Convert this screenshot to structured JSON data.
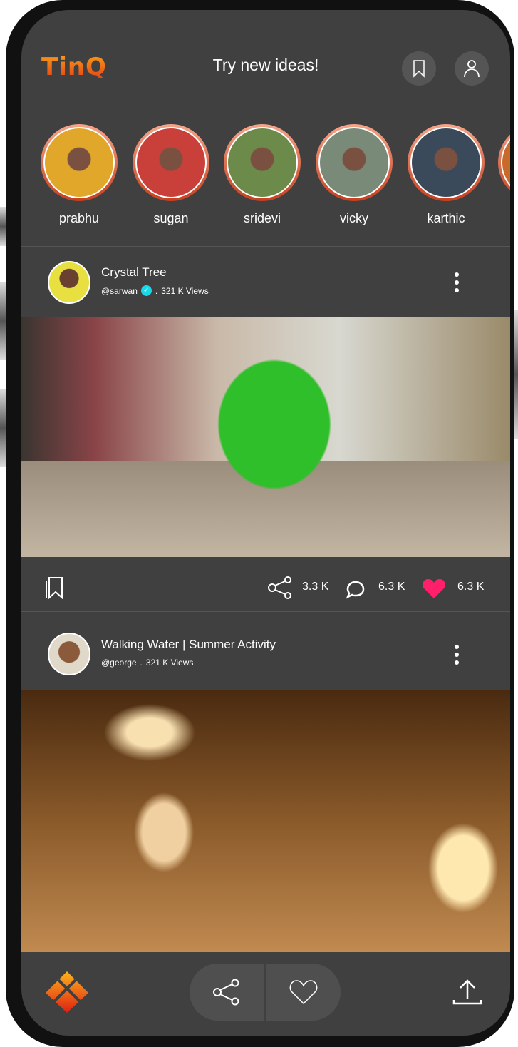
{
  "app": {
    "logo": "TinQ",
    "title": "Try new ideas!"
  },
  "header_icons": [
    "bookmark-icon",
    "user-icon"
  ],
  "stories": [
    {
      "name": "prabhu",
      "color": "#e0a72a"
    },
    {
      "name": "sugan",
      "color": "#c9403a"
    },
    {
      "name": "sridevi",
      "color": "#6c8a4a"
    },
    {
      "name": "vicky",
      "color": "#7a8a78"
    },
    {
      "name": "karthic",
      "color": "#3a4a5a"
    }
  ],
  "posts": [
    {
      "title": "Crystal Tree",
      "user": "@sarwan",
      "verified": true,
      "views": "321 K Views",
      "shares": "3.3 K",
      "comments": "6.3 K",
      "likes": "6.3 K",
      "liked": true
    },
    {
      "title": "Walking Water | Summer Activity",
      "user": "@george",
      "verified": false,
      "views": "321 K Views"
    }
  ],
  "meta_sep": ".",
  "colors": {
    "background": "#404040",
    "like": "#ff1f6b",
    "accent": "#f7a21c",
    "verified": "#19d9e6"
  },
  "bottom_nav": {
    "icons": [
      "app-logo-icon",
      "share-icon",
      "heart-icon",
      "upload-icon"
    ]
  }
}
